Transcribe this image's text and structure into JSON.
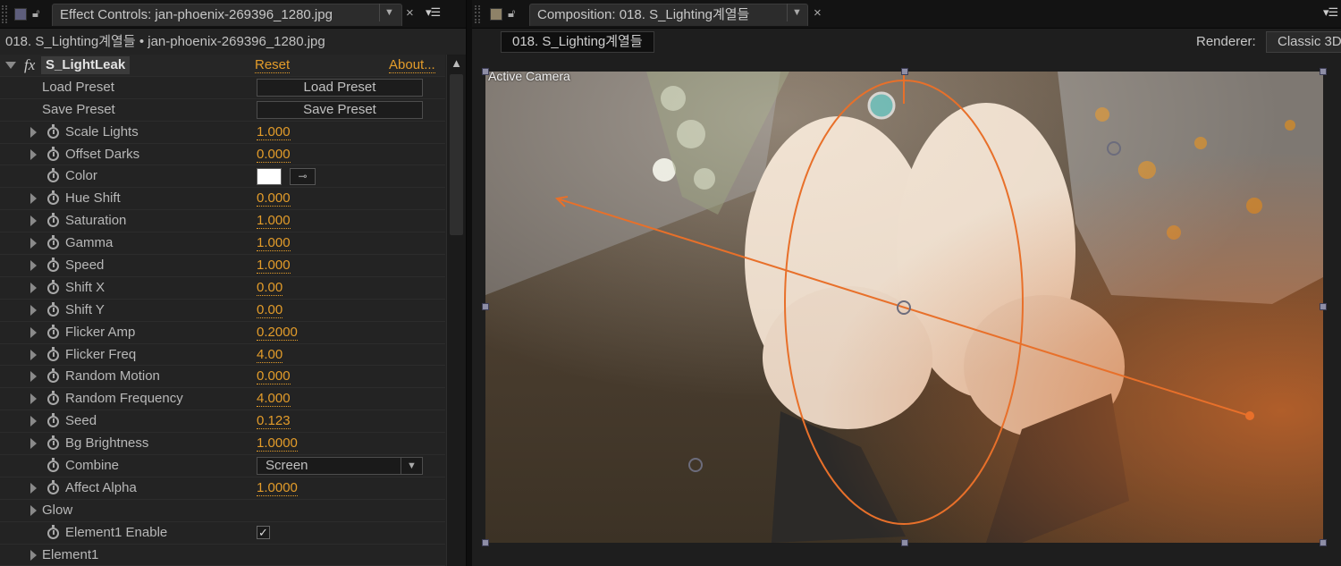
{
  "effect_panel": {
    "tab_title": "Effect Controls: jan-phoenix-269396_1280.jpg",
    "breadcrumb": "018. S_Lighting계열들 • jan-phoenix-269396_1280.jpg",
    "effect": {
      "name": "S_LightLeak",
      "reset_label": "Reset",
      "about_label": "About..."
    },
    "rows": [
      {
        "label": "Load Preset",
        "type": "button",
        "value": "Load Preset"
      },
      {
        "label": "Save Preset",
        "type": "button",
        "value": "Save Preset"
      },
      {
        "label": "Scale Lights",
        "type": "num",
        "value": "1.000"
      },
      {
        "label": "Offset Darks",
        "type": "num",
        "value": "0.000"
      },
      {
        "label": "Color",
        "type": "color",
        "value": "#ffffff"
      },
      {
        "label": "Hue Shift",
        "type": "num",
        "value": "0.000"
      },
      {
        "label": "Saturation",
        "type": "num",
        "value": "1.000"
      },
      {
        "label": "Gamma",
        "type": "num",
        "value": "1.000"
      },
      {
        "label": "Speed",
        "type": "num",
        "value": "1.000"
      },
      {
        "label": "Shift X",
        "type": "num",
        "value": "0.00"
      },
      {
        "label": "Shift Y",
        "type": "num",
        "value": "0.00"
      },
      {
        "label": "Flicker Amp",
        "type": "num",
        "value": "0.2000"
      },
      {
        "label": "Flicker Freq",
        "type": "num",
        "value": "4.00"
      },
      {
        "label": "Random Motion",
        "type": "num",
        "value": "0.000"
      },
      {
        "label": "Random Frequency",
        "type": "num",
        "value": "4.000"
      },
      {
        "label": "Seed",
        "type": "num",
        "value": "0.123"
      },
      {
        "label": "Bg Brightness",
        "type": "num",
        "value": "1.0000"
      },
      {
        "label": "Combine",
        "type": "select",
        "value": "Screen"
      },
      {
        "label": "Affect Alpha",
        "type": "num",
        "value": "1.0000"
      },
      {
        "label": "Glow",
        "type": "group"
      },
      {
        "label": "Element1 Enable",
        "type": "checkbox",
        "value": "✓"
      },
      {
        "label": "Element1",
        "type": "group"
      }
    ]
  },
  "comp_panel": {
    "tab_title": "Composition: 018. S_Lighting계열들",
    "comp_tab": "018. S_Lighting계열들",
    "renderer_label": "Renderer:",
    "renderer_value": "Classic 3D",
    "viewer_label": "Active Camera"
  },
  "colors": {
    "accent": "#e39c2a",
    "overlay": "#e8702a",
    "panel_bg": "#232323"
  },
  "icons": [
    "panel-icon",
    "lock-icon",
    "dropdown-icon",
    "close-icon",
    "panel-menu-icon",
    "fx-icon",
    "stopwatch-icon",
    "twirl-triangle-icon",
    "eyedropper-icon",
    "checkmark-icon",
    "scroll-up-icon"
  ]
}
